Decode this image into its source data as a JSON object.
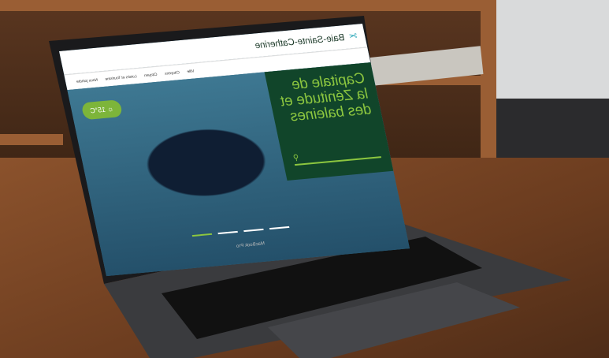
{
  "website": {
    "logo": "Baie-Sainte-Catherine",
    "nav": [
      "Ville",
      "Citoyens",
      "Citoyen",
      "Loisirs et Tourisme",
      "Nous joindre"
    ],
    "hero_title": "Capitale de la Zénitude et des baleines",
    "weather": "15°C",
    "slider": {
      "slides": 4,
      "active": 4
    }
  },
  "laptop": {
    "brand": "MacBook Pro"
  },
  "colors": {
    "brand_green": "#11452a",
    "accent": "#8cc63f"
  }
}
